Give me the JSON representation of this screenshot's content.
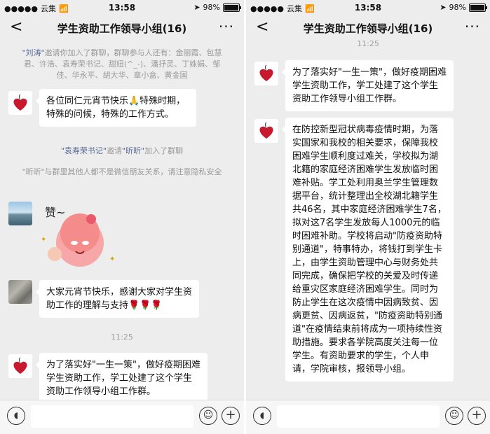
{
  "status": {
    "carrier": "云集",
    "time": "13:58",
    "battery": "98%",
    "battery_level": 0.98
  },
  "nav": {
    "back": "<",
    "title": "学生资助工作领导小组(16)",
    "more": "···"
  },
  "icons": {
    "wifi": "wifi-icon",
    "location": "location-arrow-icon",
    "voice": "voice-icon",
    "emoji": "emoji-icon",
    "plus": "plus-icon"
  },
  "left": {
    "system_invite": {
      "inviter": "\"刘涛\"",
      "text": "邀请你加入了群聊，群聊参与人还有：金丽霞、包慧君、许浩、袁寿荣书记、甜妞(^_-)、潘抒灵、丁姝娟、邹佳、华永平、胡大华、章小盒、黄金国"
    },
    "msg1": "各位同仁元宵节快乐🙏特殊时期，特殊的问候，特殊的工作方式。",
    "system_join": {
      "a": "\"袁寿荣书记\"",
      "mid": "邀请",
      "b": "\"昕昕\"",
      "tail": "加入了群聊"
    },
    "system_notice": "\"昕昕\"与群里其他人都不是微信朋友关系，请注意隐私安全",
    "sticker_text": "赞~",
    "msg2": "大家元宵节快乐，感谢大家对学生资助工作的理解与支持",
    "msg2_flowers": "🌹🌹🌹",
    "time": "11:25",
    "msg3": "为了落实好\"一生一策\"，做好疫期困难学生资助工作，学工处建了这个学生资助工作领导小组工作群。"
  },
  "right": {
    "time": "11:25",
    "msg1": "为了落实好\"一生一策\"，做好疫期困难学生资助工作，学工处建了这个学生资助工作领导小组工作群。",
    "msg2": "在防控新型冠状病毒疫情时期，为落实国家和我校的相关要求，保障我校困难学生顺利度过难关，学校拟为湖北籍的家庭经济困难学生发放临时困难补贴。学工处利用奥兰学生管理数据平台，统计整理出全校湖北籍学生共46名，其中家庭经济困难学生7名，拟对这7名学生发放每人1000元的临时困难补助。学校将启动\"防疫资助特别通道\"，特事特办，将钱打到学生卡上，由学生资助管理中心与财务处共同完成，确保把学校的关爱及时传递给重灾区家庭经济困难学生。同时为防止学生在这次疫情中因病致贫、因病更贫、因病返贫，\"防疫资助特别通道\"在疫情结束前将成为一项持续性资助措施。要求各学院高度关注每一位学生。有资助要求的学生，个人申请，学院审核，报领导小组。"
  }
}
